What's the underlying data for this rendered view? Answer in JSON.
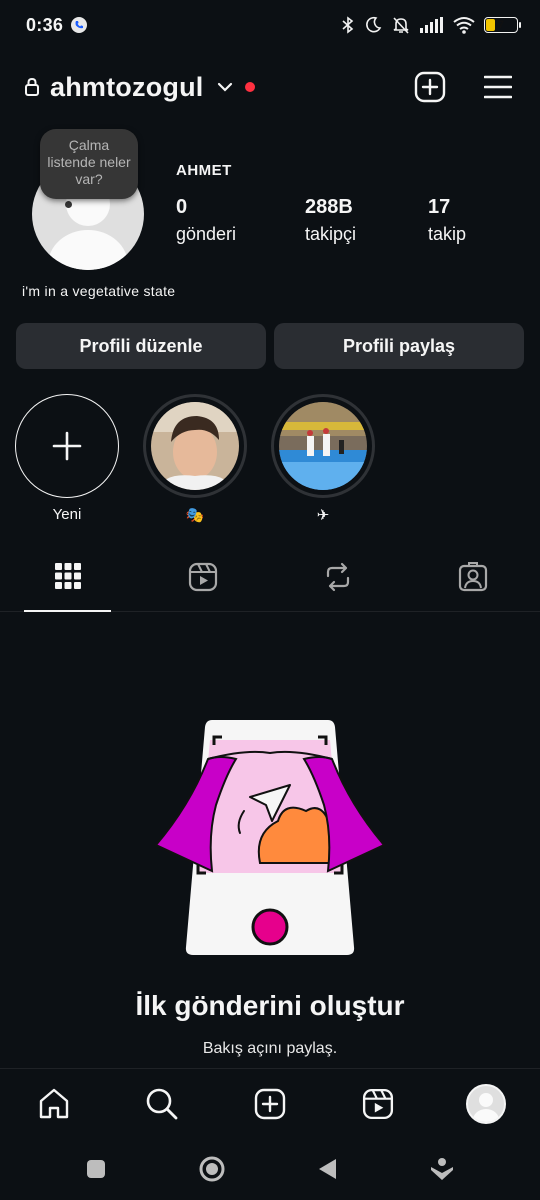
{
  "status_bar": {
    "time": "0:36",
    "battery": "7"
  },
  "header": {
    "username": "ahmtozogul"
  },
  "profile": {
    "note": "Çalma listende neler var?",
    "display_name": "AHMET",
    "stats": [
      {
        "value": "0",
        "label": "gönderi"
      },
      {
        "value": "288B",
        "label": "takipçi"
      },
      {
        "value": "17",
        "label": "takip"
      }
    ],
    "bio": "i'm in a vegetative state"
  },
  "buttons": {
    "edit": "Profili düzenle",
    "share": "Profili paylaş"
  },
  "highlights": [
    {
      "label": "Yeni"
    },
    {
      "label": "🎭"
    },
    {
      "label": "✈"
    }
  ],
  "empty_state": {
    "title": "İlk gönderini oluştur",
    "subtitle": "Bakış açını paylaş."
  },
  "colors": {
    "background": "#0c1014",
    "button": "#2a2d32",
    "notification": "#ff3040",
    "illustration_magenta": "#c800c8",
    "illustration_orange": "#ff8a3d",
    "illustration_pink": "#f7c6e8"
  }
}
